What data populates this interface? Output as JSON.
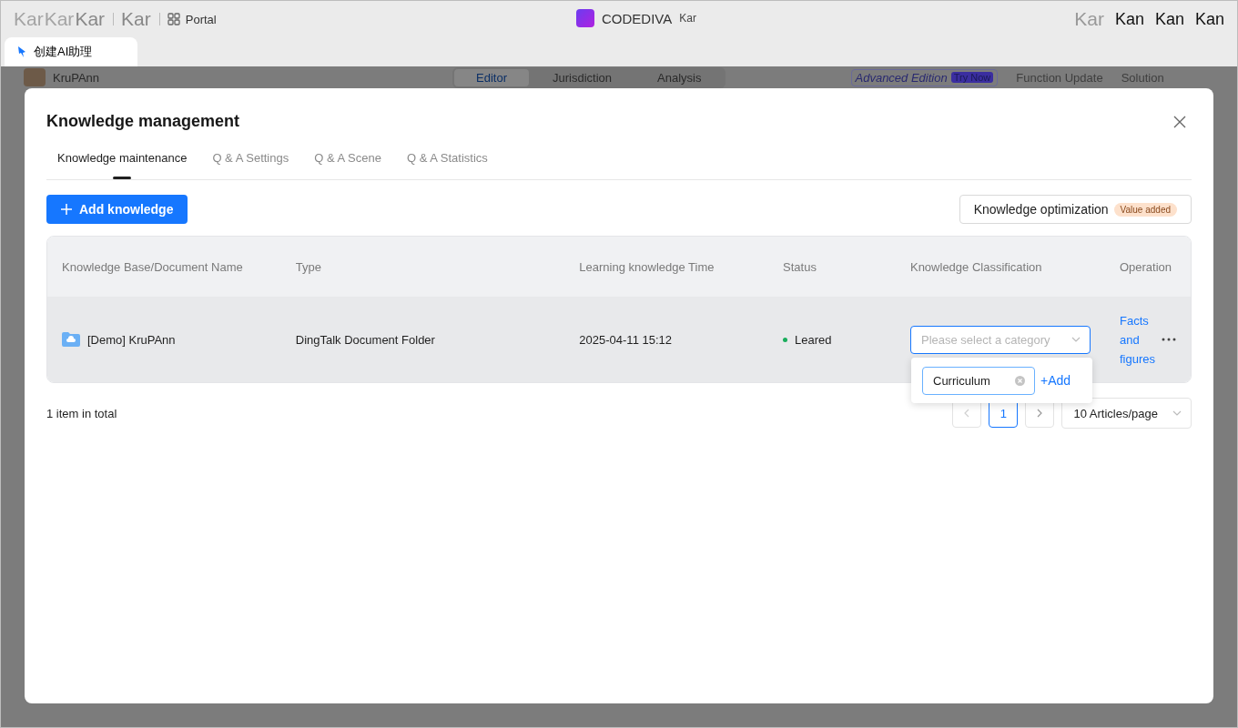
{
  "title_bar": {
    "left_marks": [
      "Kar",
      "Kar",
      "Kar",
      "Kar"
    ],
    "portal": "Portal",
    "app_name": "CODEDIVA",
    "app_suffix": "Kar",
    "right_faded": "Kar",
    "right_marks": [
      "Kan",
      "Kan",
      "Kan"
    ]
  },
  "browser_tabs": [
    {
      "label": "创建AI助理",
      "selected": true
    }
  ],
  "app_header": {
    "user": "KruPAnn",
    "tabs": [
      {
        "label": "Editor",
        "selected": true
      },
      {
        "label": "Jurisdiction",
        "selected": false
      },
      {
        "label": "Analysis",
        "selected": false
      }
    ],
    "promo": "Advanced Edition",
    "promo_badge": "Try Now",
    "links": [
      "Function Update",
      "Solution"
    ]
  },
  "dialog": {
    "title": "Knowledge management",
    "tabs": [
      {
        "label": "Knowledge maintenance",
        "selected": true
      },
      {
        "label": "Q & A Settings",
        "selected": false
      },
      {
        "label": "Q & A Scene",
        "selected": false
      },
      {
        "label": "Q & A Statistics",
        "selected": false
      }
    ],
    "add_button": "Add knowledge",
    "optimize_button": "Knowledge optimization",
    "optimize_badge": "Value added",
    "table": {
      "columns": [
        "Knowledge Base/Document Name",
        "Type",
        "Learning knowledge Time",
        "Status",
        "Knowledge Classification",
        "Operation"
      ],
      "rows": [
        {
          "name": "[Demo] KruPAnn",
          "type": "DingTalk Document Folder",
          "time": "2025-04-11 15:12",
          "status": "Leared",
          "color": "#1aad5c",
          "category_placeholder": "Please select a category",
          "operation": "Facts and figures"
        }
      ]
    },
    "category_popup": {
      "value": "Curriculum",
      "add": "+Add"
    },
    "total": "1 item in total",
    "pagination": {
      "pages": [
        {
          "label": "1",
          "selected": true
        }
      ],
      "prev_disabled": true,
      "next_disabled": false,
      "page_size": "10 Articles/page"
    }
  }
}
